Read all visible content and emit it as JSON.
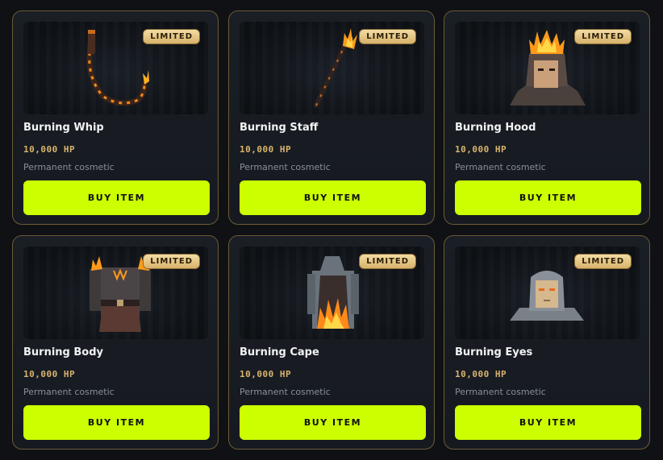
{
  "items": [
    {
      "name": "Burning Whip",
      "badge": "LIMITED",
      "price": "10,000 HP",
      "description": "Permanent cosmetic",
      "button": "BUY ITEM",
      "icon": "burning-whip-icon"
    },
    {
      "name": "Burning Staff",
      "badge": "LIMITED",
      "price": "10,000 HP",
      "description": "Permanent cosmetic",
      "button": "BUY ITEM",
      "icon": "burning-staff-icon"
    },
    {
      "name": "Burning Hood",
      "badge": "LIMITED",
      "price": "10,000 HP",
      "description": "Permanent cosmetic",
      "button": "BUY ITEM",
      "icon": "burning-hood-icon"
    },
    {
      "name": "Burning Body",
      "badge": "LIMITED",
      "price": "10,000 HP",
      "description": "Permanent cosmetic",
      "button": "BUY ITEM",
      "icon": "burning-body-icon"
    },
    {
      "name": "Burning Cape",
      "badge": "LIMITED",
      "price": "10,000 HP",
      "description": "Permanent cosmetic",
      "button": "BUY ITEM",
      "icon": "burning-cape-icon"
    },
    {
      "name": "Burning Eyes",
      "badge": "LIMITED",
      "price": "10,000 HP",
      "description": "Permanent cosmetic",
      "button": "BUY ITEM",
      "icon": "burning-eyes-icon"
    }
  ],
  "colors": {
    "accent": "#ccff00",
    "price": "#d9b46e",
    "card_border": "#6e5a36",
    "background": "#0f1115"
  }
}
